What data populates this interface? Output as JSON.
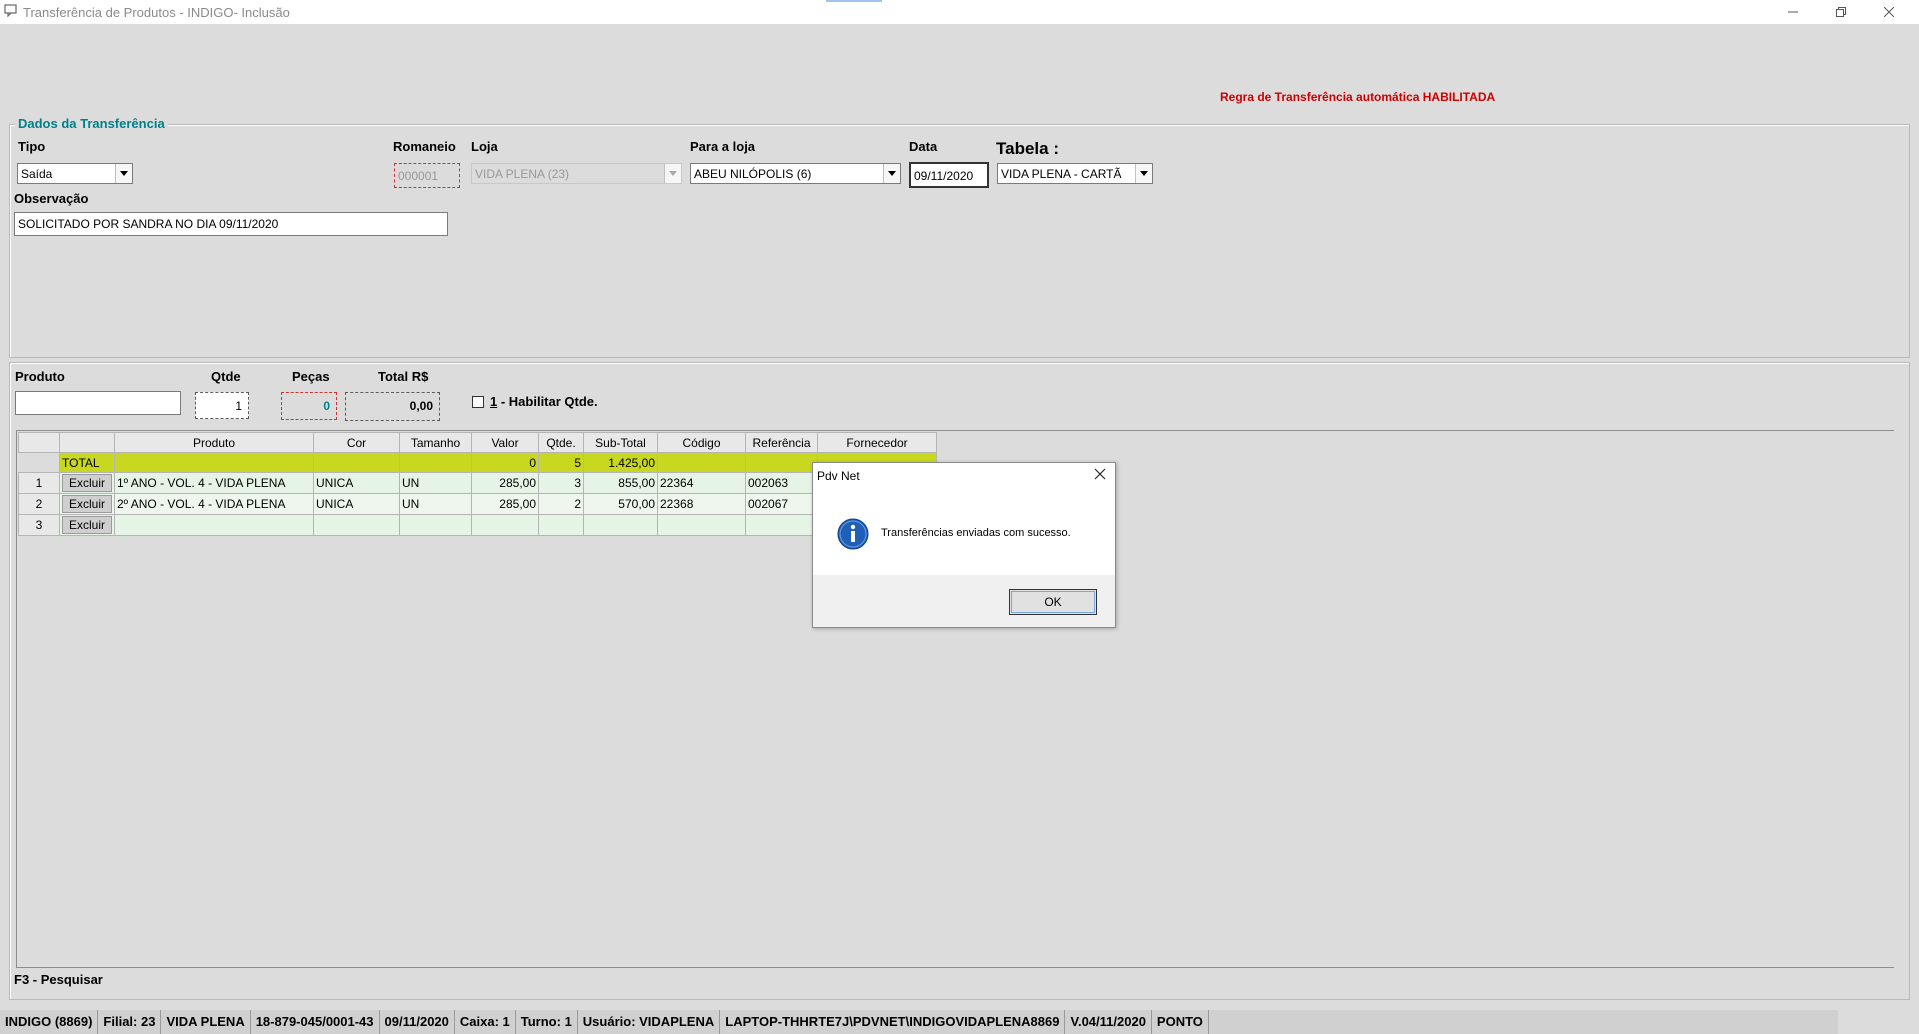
{
  "window": {
    "title": "Transferência de Produtos - INDIGO- Inclusão",
    "minimize_glyph": "—",
    "restore_glyph": "❐",
    "close_glyph": "✕"
  },
  "rule_notice": "Regra de Transferência automática HABILITADA",
  "dados": {
    "legend": "Dados da Transferência",
    "tipo_label": "Tipo",
    "tipo_value": "Saída",
    "romaneio_label": "Romaneio",
    "romaneio_value": "000001",
    "loja_label": "Loja",
    "loja_value": "VIDA PLENA (23)",
    "para_loja_label": "Para a loja",
    "para_loja_value": "ABEU NILÓPOLIS (6)",
    "data_label": "Data",
    "data_value": "09/11/2020",
    "tabela_label": "Tabela :",
    "tabela_value": "VIDA PLENA - CARTÃ",
    "observacao_label": "Observação",
    "observacao_value": "SOLICITADO POR SANDRA NO DIA 09/11/2020"
  },
  "entry": {
    "produto_label": "Produto",
    "produto_value": "",
    "qtde_label": "Qtde",
    "qtde_value": "1",
    "pecas_label": "Peças",
    "pecas_value": "0",
    "total_label": "Total R$",
    "total_value": "0,00",
    "habilitar_key": "1",
    "habilitar_label": " - Habilitar Qtde."
  },
  "grid": {
    "headers": [
      "",
      "",
      "Produto",
      "Cor",
      "Tamanho",
      "Valor",
      "Qtde.",
      "Sub-Total",
      "Código",
      "Referência",
      "Fornecedor"
    ],
    "total_row": {
      "label": "TOTAL",
      "valor": "0",
      "qtde": "5",
      "subtotal": "1.425,00"
    },
    "rows": [
      {
        "num": "1",
        "action": "Excluir",
        "produto": "1º ANO - VOL. 4 - VIDA PLENA",
        "cor": "UNICA",
        "tamanho": "UN",
        "valor": "285,00",
        "qtde": "3",
        "subtotal": "855,00",
        "codigo": "22364",
        "referencia": "002063",
        "fornecedor": ""
      },
      {
        "num": "2",
        "action": "Excluir",
        "produto": "2º ANO - VOL. 4 - VIDA PLENA",
        "cor": "UNICA",
        "tamanho": "UN",
        "valor": "285,00",
        "qtde": "2",
        "subtotal": "570,00",
        "codigo": "22368",
        "referencia": "002067",
        "fornecedor": ""
      },
      {
        "num": "3",
        "action": "Excluir",
        "produto": "",
        "cor": "",
        "tamanho": "",
        "valor": "",
        "qtde": "",
        "subtotal": "",
        "codigo": "",
        "referencia": "",
        "fornecedor": ""
      }
    ]
  },
  "hint": "F3 - Pesquisar",
  "status": [
    "INDIGO (8869)",
    "Filial: 23",
    "VIDA PLENA",
    "18-879-045/0001-43",
    "09/11/2020",
    "Caixa: 1",
    "Turno: 1",
    "Usuário: VIDAPLENA",
    "LAPTOP-THHRTE7J\\PDVNET\\INDIGOVIDAPLENA8869",
    "V.04/11/2020",
    "PONTO"
  ],
  "dialog": {
    "title": "Pdv Net",
    "message": "Transferências enviadas com sucesso.",
    "ok_label": "OK"
  },
  "colors": {
    "accent_teal": "#00818a",
    "notice_red": "#cc0000",
    "total_row": "#c8d820",
    "item_row": "#e6f4e6",
    "info_icon": "#1f5fb8"
  }
}
